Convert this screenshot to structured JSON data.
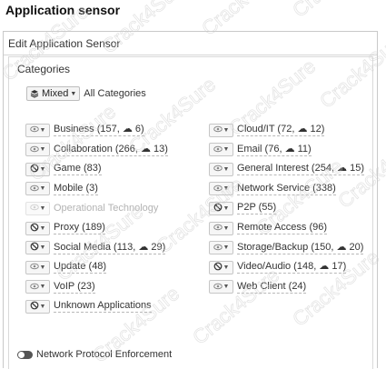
{
  "page_title": "Application sensor",
  "panel_title": "Edit Application Sensor",
  "section_title": "Categories",
  "mixed_button": {
    "label": "Mixed",
    "icon": "layers-icon"
  },
  "all_categories_label": "All Categories",
  "categories": [
    {
      "text": "Business (157, ☁ 6)",
      "action": "monitor",
      "disabled": false
    },
    {
      "text": "Cloud/IT (72, ☁ 12)",
      "action": "monitor",
      "disabled": false
    },
    {
      "text": "Collaboration (266, ☁ 13)",
      "action": "monitor",
      "disabled": false
    },
    {
      "text": "Email (76, ☁ 11)",
      "action": "monitor",
      "disabled": false
    },
    {
      "text": "Game (83)",
      "action": "block",
      "disabled": false
    },
    {
      "text": "General Interest (254, ☁ 15)",
      "action": "monitor",
      "disabled": false
    },
    {
      "text": "Mobile (3)",
      "action": "monitor",
      "disabled": false
    },
    {
      "text": "Network Service (338)",
      "action": "monitor",
      "disabled": false
    },
    {
      "text": "Operational Technology",
      "action": "monitor",
      "disabled": true
    },
    {
      "text": "P2P (55)",
      "action": "block",
      "disabled": false
    },
    {
      "text": "Proxy (189)",
      "action": "block",
      "disabled": false
    },
    {
      "text": "Remote Access (96)",
      "action": "monitor",
      "disabled": false
    },
    {
      "text": "Social Media (113, ☁ 29)",
      "action": "block",
      "disabled": false
    },
    {
      "text": "Storage/Backup (150, ☁ 20)",
      "action": "monitor",
      "disabled": false
    },
    {
      "text": "Update (48)",
      "action": "monitor",
      "disabled": false
    },
    {
      "text": "Video/Audio (148, ☁ 17)",
      "action": "block",
      "disabled": false
    },
    {
      "text": "VoIP (23)",
      "action": "monitor",
      "disabled": false
    },
    {
      "text": "Web Client (24)",
      "action": "monitor",
      "disabled": false
    },
    {
      "text": "Unknown Applications",
      "action": "block",
      "disabled": false
    }
  ],
  "toggle": {
    "label": "Network Protocol Enforcement",
    "state": "off"
  },
  "watermark": "Crack4Sure"
}
